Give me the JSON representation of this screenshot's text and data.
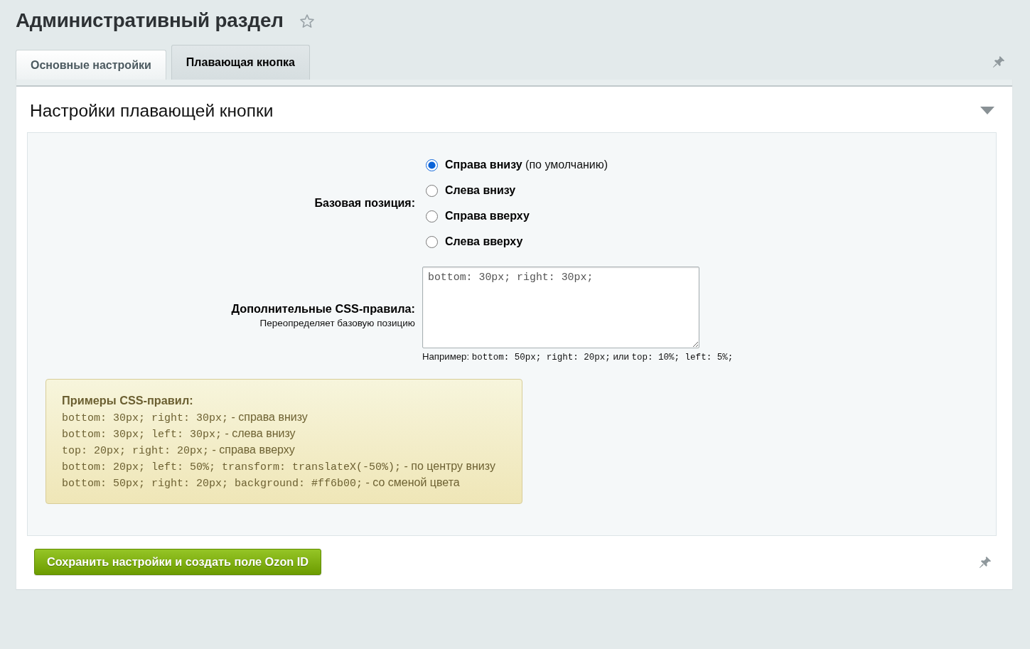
{
  "header": {
    "title": "Административный раздел",
    "favorite": false
  },
  "tabs": [
    {
      "label": "Основные настройки",
      "selected": false
    },
    {
      "label": "Плавающая кнопка",
      "selected": true
    }
  ],
  "section": {
    "title": "Настройки плавающей кнопки",
    "expanded": true,
    "position": {
      "label": "Базовая позиция:",
      "options": [
        {
          "label": "Справа внизу",
          "note": "(по умолчанию)",
          "selected": true
        },
        {
          "label": "Слева внизу",
          "selected": false
        },
        {
          "label": "Справа вверху",
          "selected": false
        },
        {
          "label": "Слева вверху",
          "selected": false
        }
      ]
    },
    "css_rules": {
      "label": "Дополнительные CSS-правила:",
      "description": "Переопределяет базовую позицию",
      "value": "bottom: 30px; right: 30px;",
      "hint": [
        {
          "kind": "text",
          "text": "Например:"
        },
        {
          "kind": "code",
          "text": "bottom: 50px; right: 20px;"
        },
        {
          "kind": "text",
          "text": "или"
        },
        {
          "kind": "code",
          "text": "top: 10%; left: 5%;"
        }
      ]
    },
    "examples": {
      "title": "Примеры CSS-правил:",
      "items": [
        {
          "code": "bottom: 30px; right: 30px;",
          "text": "- справа внизу"
        },
        {
          "code": "bottom: 30px; left: 30px;",
          "text": "- слева внизу"
        },
        {
          "code": "top: 20px; right: 20px;",
          "text": "- справа вверху"
        },
        {
          "code": "bottom: 20px; left: 50%; transform: translateX(-50%);",
          "text": "- по центру внизу"
        },
        {
          "code": "bottom: 50px; right: 20px; background: #ff6b00;",
          "text": "- со сменой цвета"
        }
      ]
    }
  },
  "footer": {
    "save_button": "Сохранить настройки и создать поле Ozon ID"
  }
}
